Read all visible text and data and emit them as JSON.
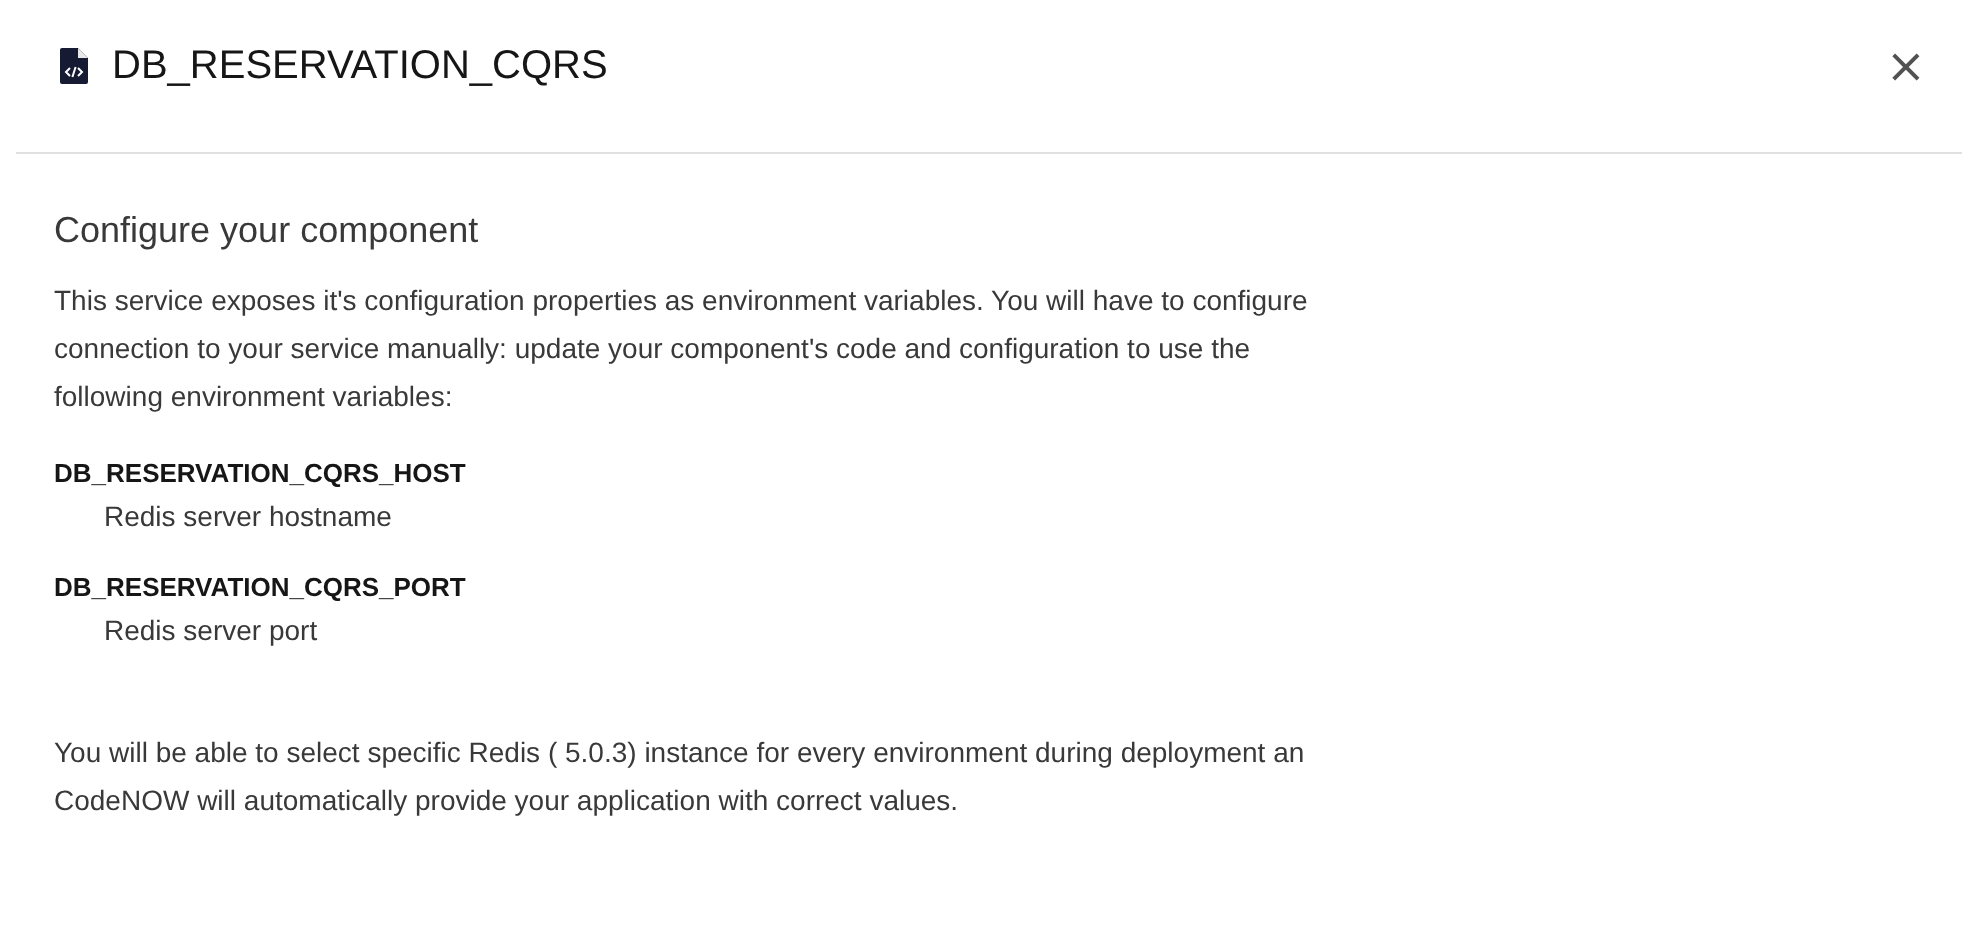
{
  "header": {
    "title": "DB_RESERVATION_CQRS",
    "close": "×"
  },
  "section": {
    "heading": "Configure your component",
    "intro_lines": [
      "This service exposes it's configuration properties as environment variables. You will have to configure",
      "connection to your service manually: update your component's code and configuration to use the",
      "following environment variables:"
    ],
    "variables": [
      {
        "name": "DB_RESERVATION_CQRS_HOST",
        "description": "Redis server hostname"
      },
      {
        "name": "DB_RESERVATION_CQRS_PORT",
        "description": "Redis server port"
      }
    ],
    "outro_lines": [
      "You will be able to select specific Redis ( 5.0.3) instance for every environment during deployment an",
      "CodeNOW will automatically provide your application with correct values."
    ]
  }
}
